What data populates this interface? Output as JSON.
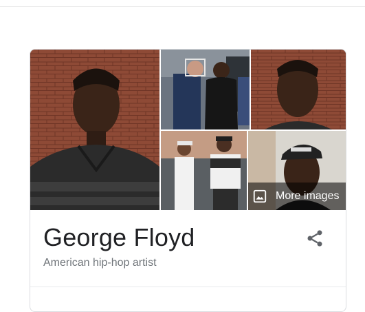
{
  "knowledge_panel": {
    "title": "George Floyd",
    "subtitle": "American hip-hop artist",
    "more_images_label": "More images",
    "share_icon": "share-icon",
    "images": [
      {
        "name": "main-portrait-image"
      },
      {
        "name": "arrest-photo-image"
      },
      {
        "name": "portrait-close-image"
      },
      {
        "name": "two-men-photo-image"
      },
      {
        "name": "cap-selfie-image"
      }
    ]
  },
  "colors": {
    "title": "#202124",
    "subtitle": "#70757a",
    "share_icon": "#5f6368",
    "card_border": "#dadce0"
  }
}
